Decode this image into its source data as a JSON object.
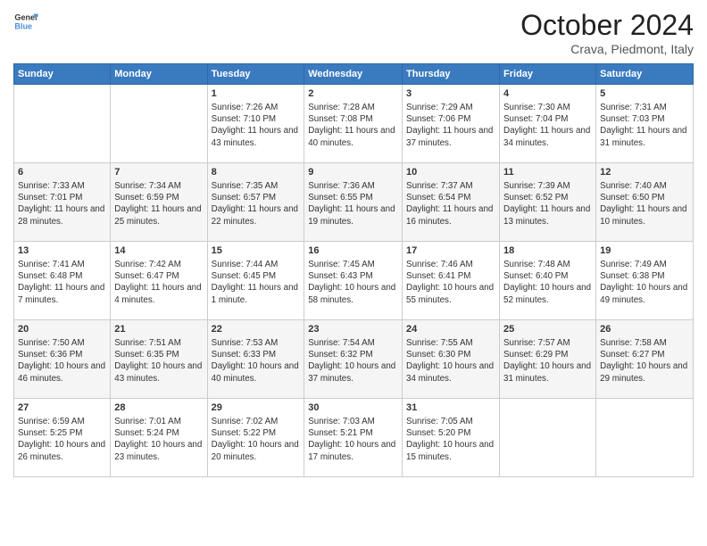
{
  "header": {
    "logo_line1": "General",
    "logo_line2": "Blue",
    "month": "October 2024",
    "location": "Crava, Piedmont, Italy"
  },
  "weekdays": [
    "Sunday",
    "Monday",
    "Tuesday",
    "Wednesday",
    "Thursday",
    "Friday",
    "Saturday"
  ],
  "weeks": [
    [
      {
        "day": "",
        "info": ""
      },
      {
        "day": "",
        "info": ""
      },
      {
        "day": "1",
        "info": "Sunrise: 7:26 AM\nSunset: 7:10 PM\nDaylight: 11 hours and 43 minutes."
      },
      {
        "day": "2",
        "info": "Sunrise: 7:28 AM\nSunset: 7:08 PM\nDaylight: 11 hours and 40 minutes."
      },
      {
        "day": "3",
        "info": "Sunrise: 7:29 AM\nSunset: 7:06 PM\nDaylight: 11 hours and 37 minutes."
      },
      {
        "day": "4",
        "info": "Sunrise: 7:30 AM\nSunset: 7:04 PM\nDaylight: 11 hours and 34 minutes."
      },
      {
        "day": "5",
        "info": "Sunrise: 7:31 AM\nSunset: 7:03 PM\nDaylight: 11 hours and 31 minutes."
      }
    ],
    [
      {
        "day": "6",
        "info": "Sunrise: 7:33 AM\nSunset: 7:01 PM\nDaylight: 11 hours and 28 minutes."
      },
      {
        "day": "7",
        "info": "Sunrise: 7:34 AM\nSunset: 6:59 PM\nDaylight: 11 hours and 25 minutes."
      },
      {
        "day": "8",
        "info": "Sunrise: 7:35 AM\nSunset: 6:57 PM\nDaylight: 11 hours and 22 minutes."
      },
      {
        "day": "9",
        "info": "Sunrise: 7:36 AM\nSunset: 6:55 PM\nDaylight: 11 hours and 19 minutes."
      },
      {
        "day": "10",
        "info": "Sunrise: 7:37 AM\nSunset: 6:54 PM\nDaylight: 11 hours and 16 minutes."
      },
      {
        "day": "11",
        "info": "Sunrise: 7:39 AM\nSunset: 6:52 PM\nDaylight: 11 hours and 13 minutes."
      },
      {
        "day": "12",
        "info": "Sunrise: 7:40 AM\nSunset: 6:50 PM\nDaylight: 11 hours and 10 minutes."
      }
    ],
    [
      {
        "day": "13",
        "info": "Sunrise: 7:41 AM\nSunset: 6:48 PM\nDaylight: 11 hours and 7 minutes."
      },
      {
        "day": "14",
        "info": "Sunrise: 7:42 AM\nSunset: 6:47 PM\nDaylight: 11 hours and 4 minutes."
      },
      {
        "day": "15",
        "info": "Sunrise: 7:44 AM\nSunset: 6:45 PM\nDaylight: 11 hours and 1 minute."
      },
      {
        "day": "16",
        "info": "Sunrise: 7:45 AM\nSunset: 6:43 PM\nDaylight: 10 hours and 58 minutes."
      },
      {
        "day": "17",
        "info": "Sunrise: 7:46 AM\nSunset: 6:41 PM\nDaylight: 10 hours and 55 minutes."
      },
      {
        "day": "18",
        "info": "Sunrise: 7:48 AM\nSunset: 6:40 PM\nDaylight: 10 hours and 52 minutes."
      },
      {
        "day": "19",
        "info": "Sunrise: 7:49 AM\nSunset: 6:38 PM\nDaylight: 10 hours and 49 minutes."
      }
    ],
    [
      {
        "day": "20",
        "info": "Sunrise: 7:50 AM\nSunset: 6:36 PM\nDaylight: 10 hours and 46 minutes."
      },
      {
        "day": "21",
        "info": "Sunrise: 7:51 AM\nSunset: 6:35 PM\nDaylight: 10 hours and 43 minutes."
      },
      {
        "day": "22",
        "info": "Sunrise: 7:53 AM\nSunset: 6:33 PM\nDaylight: 10 hours and 40 minutes."
      },
      {
        "day": "23",
        "info": "Sunrise: 7:54 AM\nSunset: 6:32 PM\nDaylight: 10 hours and 37 minutes."
      },
      {
        "day": "24",
        "info": "Sunrise: 7:55 AM\nSunset: 6:30 PM\nDaylight: 10 hours and 34 minutes."
      },
      {
        "day": "25",
        "info": "Sunrise: 7:57 AM\nSunset: 6:29 PM\nDaylight: 10 hours and 31 minutes."
      },
      {
        "day": "26",
        "info": "Sunrise: 7:58 AM\nSunset: 6:27 PM\nDaylight: 10 hours and 29 minutes."
      }
    ],
    [
      {
        "day": "27",
        "info": "Sunrise: 6:59 AM\nSunset: 5:25 PM\nDaylight: 10 hours and 26 minutes."
      },
      {
        "day": "28",
        "info": "Sunrise: 7:01 AM\nSunset: 5:24 PM\nDaylight: 10 hours and 23 minutes."
      },
      {
        "day": "29",
        "info": "Sunrise: 7:02 AM\nSunset: 5:22 PM\nDaylight: 10 hours and 20 minutes."
      },
      {
        "day": "30",
        "info": "Sunrise: 7:03 AM\nSunset: 5:21 PM\nDaylight: 10 hours and 17 minutes."
      },
      {
        "day": "31",
        "info": "Sunrise: 7:05 AM\nSunset: 5:20 PM\nDaylight: 10 hours and 15 minutes."
      },
      {
        "day": "",
        "info": ""
      },
      {
        "day": "",
        "info": ""
      }
    ]
  ]
}
